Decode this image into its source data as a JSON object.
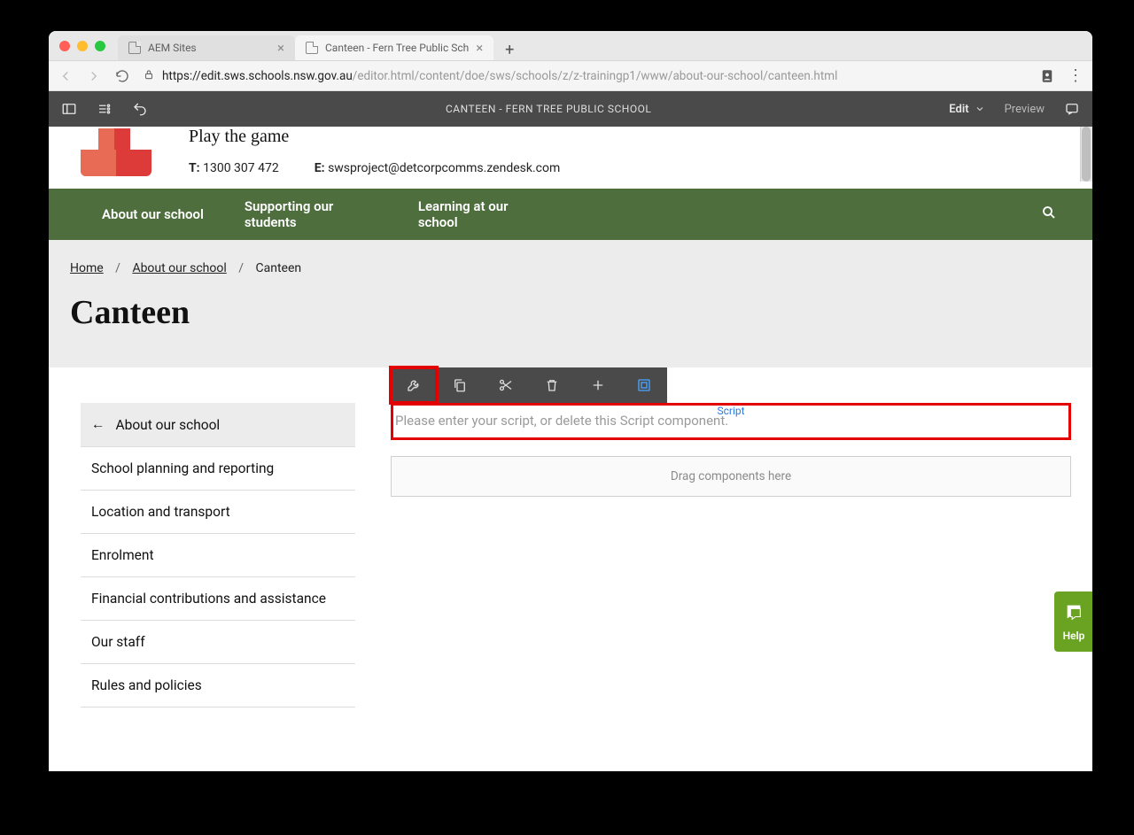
{
  "browser": {
    "tabs": [
      {
        "label": "AEM Sites",
        "active": false
      },
      {
        "label": "Canteen - Fern Tree Public Sch",
        "active": true
      }
    ],
    "url_host": "https://edit.sws.schools.nsw.gov.au",
    "url_path": "/editor.html/content/doe/sws/schools/z/z-trainingp1/www/about-our-school/canteen.html"
  },
  "aem": {
    "title": "CANTEEN - FERN TREE PUBLIC SCHOOL",
    "edit_label": "Edit",
    "preview_label": "Preview"
  },
  "site": {
    "tagline": "Play the game",
    "phone_label": "T:",
    "phone": "1300 307 472",
    "email_label": "E:",
    "email": "swsproject@detcorpcomms.zendesk.com"
  },
  "nav": {
    "items": [
      "About our school",
      "Supporting our students",
      "Learning at our school"
    ]
  },
  "breadcrumbs": {
    "home": "Home",
    "about": "About our school",
    "current": "Canteen"
  },
  "page": {
    "title": "Canteen"
  },
  "sidenav": {
    "back": "About our school",
    "items": [
      "School planning and reporting",
      "Location and transport",
      "Enrolment",
      "Financial contributions and assistance",
      "Our staff",
      "Rules and policies"
    ]
  },
  "component": {
    "script_label": "Script",
    "script_placeholder": "Please enter your script, or delete this Script component.",
    "dropzone": "Drag components here"
  },
  "help": {
    "label": "Help"
  }
}
